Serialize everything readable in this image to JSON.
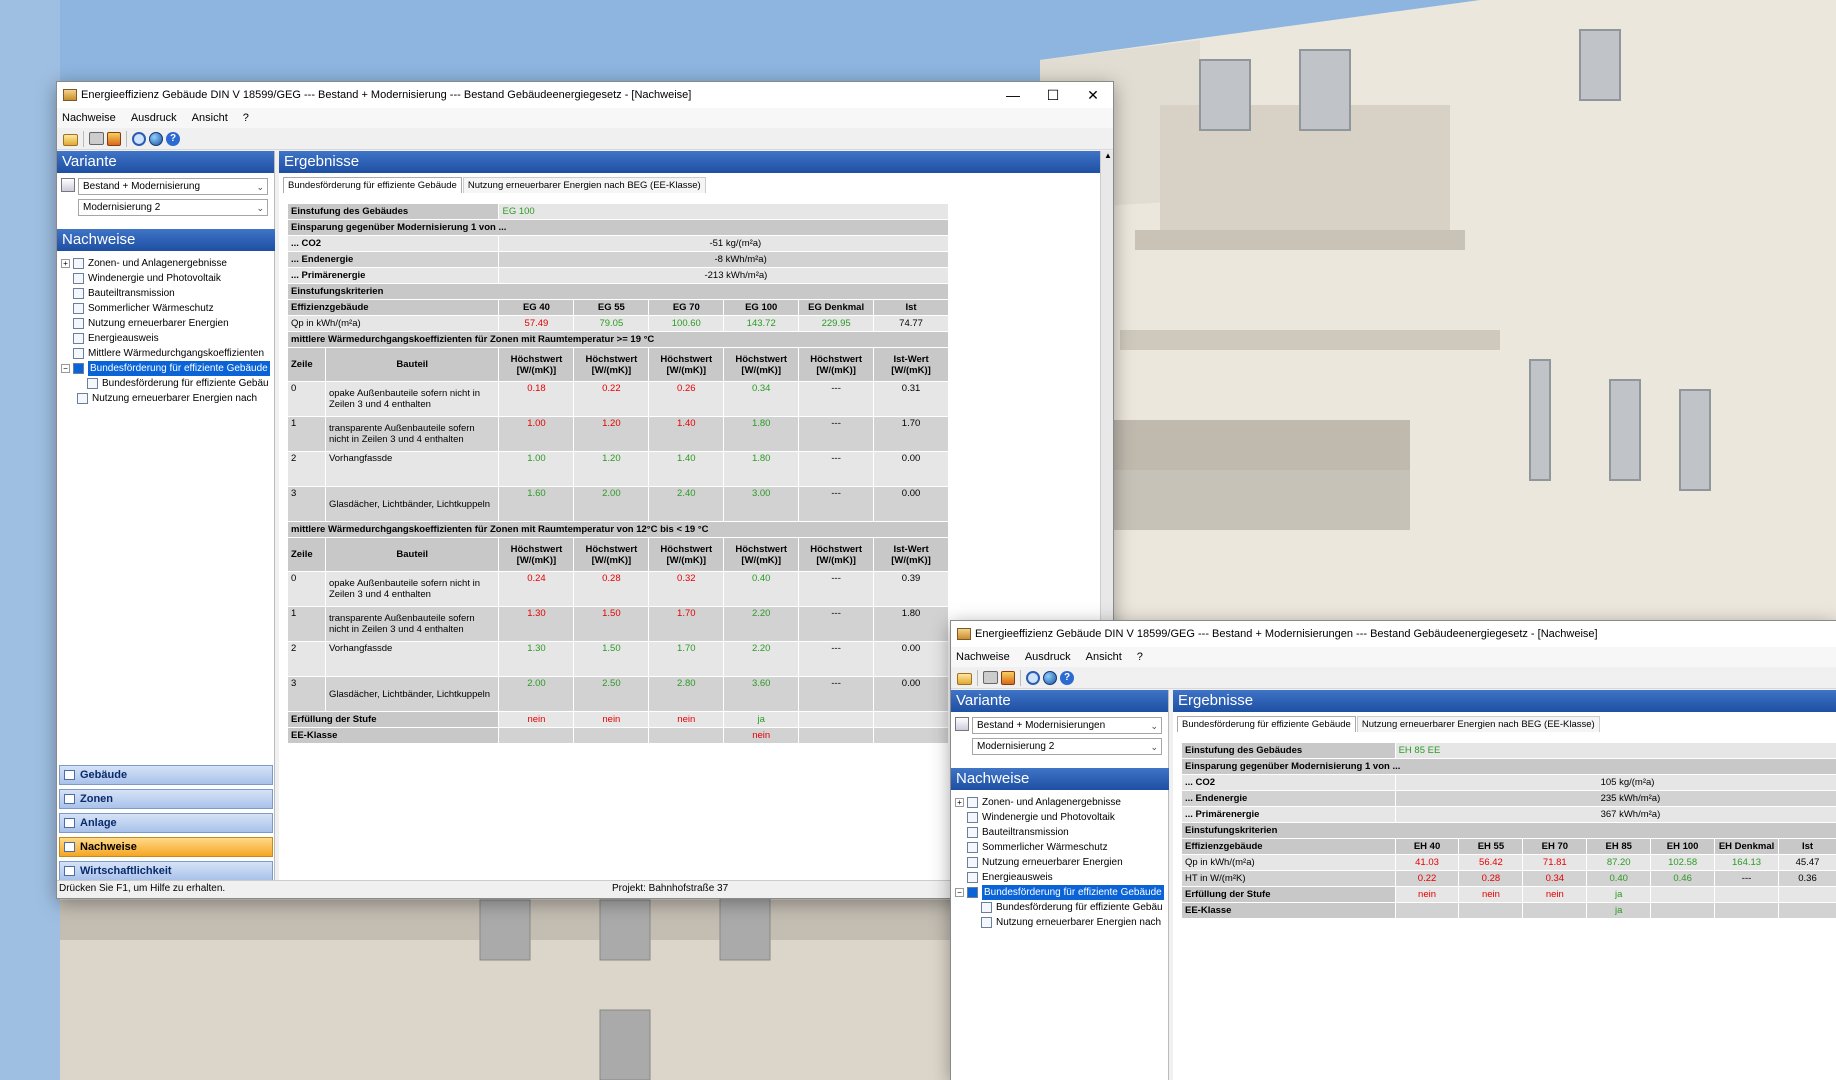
{
  "window1": {
    "title": "Energieeffizienz Gebäude DIN V 18599/GEG --- Bestand + Modernisierung --- Bestand Gebäudeenergiegesetz - [Nachweise]",
    "menu": [
      "Nachweise",
      "Ausdruck",
      "Ansicht",
      "?"
    ],
    "variante_header": "Variante",
    "combo1": "Bestand + Modernisierung",
    "combo2": "Modernisierung 2",
    "nachweise_header": "Nachweise",
    "tree": [
      "Zonen- und Anlagenergebnisse",
      "Windenergie und Photovoltaik",
      "Bauteiltransmission",
      "Sommerlicher Wärmeschutz",
      "Nutzung erneuerbarer Energien",
      "Energieausweis",
      "Mittlere Wärmedurchgangskoeffizienten",
      "Bundesförderung für effiziente Gebäude"
    ],
    "subtree": [
      "Bundesförderung für effiziente Gebäu",
      "Nutzung erneuerbarer Energien nach"
    ],
    "nav": [
      "Gebäude",
      "Zonen",
      "Anlage",
      "Nachweise",
      "Wirtschaftlichkeit"
    ],
    "status_left": "Drücken Sie F1, um Hilfe zu erhalten.",
    "status_project": "Projekt: Bahnhofstraße 37",
    "ergebnisse_header": "Ergebnisse",
    "tabs": [
      "Bundesförderung für effiziente Gebäude",
      "Nutzung erneuerbarer Energien nach BEG (EE-Klasse)"
    ],
    "einstufung_label": "Einstufung des Gebäudes",
    "einstufung_value": "EG 100",
    "einsparung_label": "Einsparung gegenüber Modernisierung 1 von ...",
    "einsparung": [
      {
        "label": "... CO2",
        "value": "-51",
        "unit": "kg/(m²a)"
      },
      {
        "label": "... Endenergie",
        "value": "-8",
        "unit": "kWh/m²a)"
      },
      {
        "label": "... Primärenergie",
        "value": "-213",
        "unit": "kWh/m²a)"
      }
    ],
    "kriterien_label": "Einstufungskriterien",
    "eff_header": [
      "Effizienzgebäude",
      "EG 40",
      "EG 55",
      "EG 70",
      "EG 100",
      "EG Denkmal",
      "Ist"
    ],
    "qp_row": [
      "Qp in kWh/(m²a)",
      "57.49",
      "79.05",
      "100.60",
      "143.72",
      "229.95",
      "74.77"
    ],
    "u_section1": "mittlere Wärmedurchgangskoeffizienten für Zonen mit Raumtemperatur >= 19 °C",
    "u_section2": "mittlere Wärmedurchgangskoeffizienten für Zonen mit Raumtemperatur von 12°C bis < 19 °C",
    "u_header": [
      "Zeile",
      "Bauteil",
      "Höchstwert [W/(mK)]",
      "Höchstwert [W/(mK)]",
      "Höchstwert [W/(mK)]",
      "Höchstwert [W/(mK)]",
      "Höchstwert [W/(mK)]",
      "Ist-Wert [W/(mK)]"
    ],
    "u_rows1": [
      [
        "0",
        "opake Außenbauteile sofern nicht in Zeilen 3 und 4 enthalten",
        "0.18",
        "0.22",
        "0.26",
        "0.34",
        "---",
        "0.31"
      ],
      [
        "1",
        "transparente Außenbauteile sofern nicht in Zeilen 3 und 4 enthalten",
        "1.00",
        "1.20",
        "1.40",
        "1.80",
        "---",
        "1.70"
      ],
      [
        "2",
        "Vorhangfassde",
        "1.00",
        "1.20",
        "1.40",
        "1.80",
        "---",
        "0.00"
      ],
      [
        "3",
        "Glasdächer, Lichtbänder, Lichtkuppeln",
        "1.60",
        "2.00",
        "2.40",
        "3.00",
        "---",
        "0.00"
      ]
    ],
    "u_rows2": [
      [
        "0",
        "opake Außenbauteile sofern nicht in Zeilen 3 und 4 enthalten",
        "0.24",
        "0.28",
        "0.32",
        "0.40",
        "---",
        "0.39"
      ],
      [
        "1",
        "transparente Außenbauteile sofern nicht in Zeilen 3 und 4 enthalten",
        "1.30",
        "1.50",
        "1.70",
        "2.20",
        "---",
        "1.80"
      ],
      [
        "2",
        "Vorhangfassde",
        "1.30",
        "1.50",
        "1.70",
        "2.20",
        "---",
        "0.00"
      ],
      [
        "3",
        "Glasdächer, Lichtbänder, Lichtkuppeln",
        "2.00",
        "2.50",
        "2.80",
        "3.60",
        "---",
        "0.00"
      ]
    ],
    "erfuellung_label": "Erfüllung der Stufe",
    "erfuellung": [
      "nein",
      "nein",
      "nein",
      "ja"
    ],
    "ee_label": "EE-Klasse",
    "ee_value": "nein"
  },
  "window2": {
    "title": "Energieeffizienz Gebäude DIN V 18599/GEG --- Bestand + Modernisierungen --- Bestand Gebäudeenergiegesetz - [Nachweise]",
    "menu": [
      "Nachweise",
      "Ausdruck",
      "Ansicht",
      "?"
    ],
    "variante_header": "Variante",
    "combo1": "Bestand + Modernisierungen",
    "combo2": "Modernisierung 2",
    "nachweise_header": "Nachweise",
    "tree": [
      "Zonen- und Anlagenergebnisse",
      "Windenergie und Photovoltaik",
      "Bauteiltransmission",
      "Sommerlicher Wärmeschutz",
      "Nutzung erneuerbarer Energien",
      "Energieausweis",
      "Bundesförderung für effiziente Gebäude"
    ],
    "subtree": [
      "Bundesförderung für effiziente Gebäu",
      "Nutzung erneuerbarer Energien nach"
    ],
    "ergebnisse_header": "Ergebnisse",
    "tabs": [
      "Bundesförderung für effiziente Gebäude",
      "Nutzung erneuerbarer Energien nach BEG (EE-Klasse)"
    ],
    "einstufung_label": "Einstufung des Gebäudes",
    "einstufung_value": "EH 85 EE",
    "einsparung_label": "Einsparung gegenüber Modernisierung 1 von ...",
    "einsparung": [
      {
        "label": "... CO2",
        "value": "105",
        "unit": "kg/(m²a)"
      },
      {
        "label": "... Endenergie",
        "value": "235",
        "unit": "kWh/m²a)"
      },
      {
        "label": "... Primärenergie",
        "value": "367",
        "unit": "kWh/m²a)"
      }
    ],
    "kriterien_label": "Einstufungskriterien",
    "eff_header": [
      "Effizienzgebäude",
      "EH 40",
      "EH 55",
      "EH 70",
      "EH 85",
      "EH 100",
      "EH Denkmal",
      "Ist"
    ],
    "qp_row": [
      "Qp in kWh/(m²a)",
      "41.03",
      "56.42",
      "71.81",
      "87.20",
      "102.58",
      "164.13",
      "45.47"
    ],
    "ht_row": [
      "HT in W/(m²K)",
      "0.22",
      "0.28",
      "0.34",
      "0.40",
      "0.46",
      "---",
      "0.36"
    ],
    "erfuellung_label": "Erfüllung der Stufe",
    "erfuellung": [
      "nein",
      "nein",
      "nein",
      "ja"
    ],
    "ee_label": "EE-Klasse",
    "ee_value": "ja"
  },
  "colors": {
    "accent": "#1e4fa3",
    "red": "#e60000",
    "green": "#2b9b24",
    "selected": "#0a64d8",
    "active_nav": "#f5a623"
  }
}
